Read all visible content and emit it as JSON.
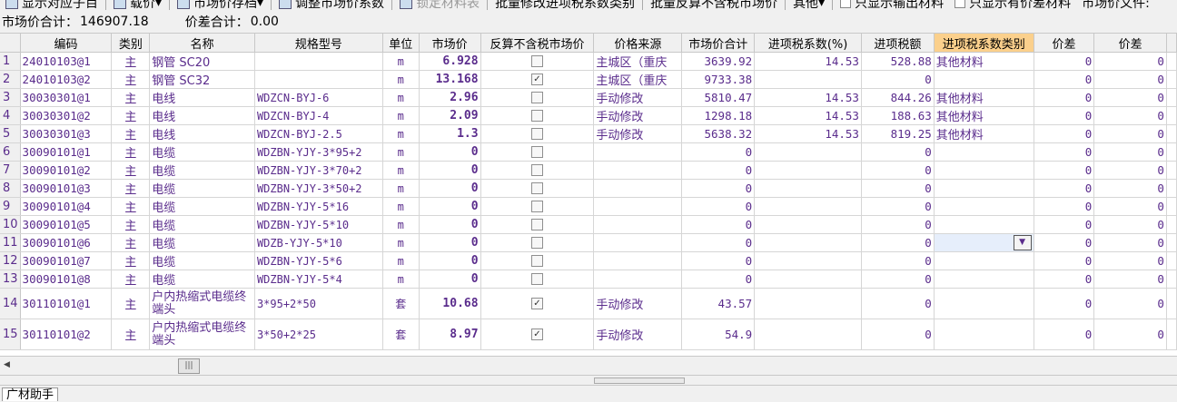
{
  "toolbar": {
    "items": [
      {
        "label": "显示对应子目",
        "icon": "display-icon"
      },
      {
        "label": "载价",
        "icon": "load-price-icon",
        "dropdown": true
      },
      {
        "label": "市场价存档",
        "icon": "archive-icon",
        "dropdown": true
      },
      {
        "label": "调整市场价系数",
        "icon": "adjust-icon"
      },
      {
        "label": "锁定材料表",
        "icon": "lock-icon",
        "disabled": true
      },
      {
        "label": "批量修改进项税系数类别"
      },
      {
        "label": "批量反算不含税市场价"
      },
      {
        "label": "其他",
        "dropdown": true
      }
    ],
    "check_output": "只显示输出材料",
    "check_diff": "只显示有价差材料",
    "market_file": "市场价文件:"
  },
  "summary": {
    "market_total_label": "市场价合计：",
    "market_total_value": "146907.18",
    "diff_total_label": "价差合计：",
    "diff_total_value": "0.00"
  },
  "columns": [
    "编码",
    "类别",
    "名称",
    "规格型号",
    "单位",
    "市场价",
    "反算不含税市场价",
    "价格来源",
    "市场价合计",
    "进项税系数(%)",
    "进项税额",
    "进项税系数类别",
    "价差",
    "价差"
  ],
  "rows": [
    {
      "n": "1",
      "code": "24010103@1",
      "type": "主",
      "name": "钢管 SC20",
      "spec": "",
      "unit": "m",
      "price": "6.928",
      "checked": false,
      "source": "主城区（重庆",
      "total": "3639.92",
      "rate": "14.53",
      "tax": "528.88",
      "cat": "其他材料",
      "d1": "0",
      "d2": "0"
    },
    {
      "n": "2",
      "code": "24010103@2",
      "type": "主",
      "name": "钢管 SC32",
      "spec": "",
      "unit": "m",
      "price": "13.168",
      "checked": true,
      "source": "主城区（重庆",
      "total": "9733.38",
      "rate": "",
      "tax": "0",
      "cat": "",
      "d1": "0",
      "d2": "0"
    },
    {
      "n": "3",
      "code": "30030301@1",
      "type": "主",
      "name": "电线",
      "spec": "WDZCN-BYJ-6",
      "unit": "m",
      "price": "2.96",
      "checked": false,
      "source": "手动修改",
      "total": "5810.47",
      "rate": "14.53",
      "tax": "844.26",
      "cat": "其他材料",
      "d1": "0",
      "d2": "0"
    },
    {
      "n": "4",
      "code": "30030301@2",
      "type": "主",
      "name": "电线",
      "spec": "WDZCN-BYJ-4",
      "unit": "m",
      "price": "2.09",
      "checked": false,
      "source": "手动修改",
      "total": "1298.18",
      "rate": "14.53",
      "tax": "188.63",
      "cat": "其他材料",
      "d1": "0",
      "d2": "0"
    },
    {
      "n": "5",
      "code": "30030301@3",
      "type": "主",
      "name": "电线",
      "spec": "WDZCN-BYJ-2.5",
      "unit": "m",
      "price": "1.3",
      "checked": false,
      "source": "手动修改",
      "total": "5638.32",
      "rate": "14.53",
      "tax": "819.25",
      "cat": "其他材料",
      "d1": "0",
      "d2": "0"
    },
    {
      "n": "6",
      "code": "30090101@1",
      "type": "主",
      "name": "电缆",
      "spec": "WDZBN-YJY-3*95+2",
      "unit": "m",
      "price": "0",
      "checked": false,
      "source": "",
      "total": "0",
      "rate": "",
      "tax": "0",
      "cat": "",
      "d1": "0",
      "d2": "0"
    },
    {
      "n": "7",
      "code": "30090101@2",
      "type": "主",
      "name": "电缆",
      "spec": "WDZBN-YJY-3*70+2",
      "unit": "m",
      "price": "0",
      "checked": false,
      "source": "",
      "total": "0",
      "rate": "",
      "tax": "0",
      "cat": "",
      "d1": "0",
      "d2": "0"
    },
    {
      "n": "8",
      "code": "30090101@3",
      "type": "主",
      "name": "电缆",
      "spec": "WDZBN-YJY-3*50+2",
      "unit": "m",
      "price": "0",
      "checked": false,
      "source": "",
      "total": "0",
      "rate": "",
      "tax": "0",
      "cat": "",
      "d1": "0",
      "d2": "0"
    },
    {
      "n": "9",
      "code": "30090101@4",
      "type": "主",
      "name": "电缆",
      "spec": "WDZBN-YJY-5*16",
      "unit": "m",
      "price": "0",
      "checked": false,
      "source": "",
      "total": "0",
      "rate": "",
      "tax": "0",
      "cat": "",
      "d1": "0",
      "d2": "0"
    },
    {
      "n": "10",
      "code": "30090101@5",
      "type": "主",
      "name": "电缆",
      "spec": "WDZBN-YJY-5*10",
      "unit": "m",
      "price": "0",
      "checked": false,
      "source": "",
      "total": "0",
      "rate": "",
      "tax": "0",
      "cat": "",
      "d1": "0",
      "d2": "0"
    },
    {
      "n": "11",
      "code": "30090101@6",
      "type": "主",
      "name": "电缆",
      "spec": "WDZB-YJY-5*10",
      "unit": "m",
      "price": "0",
      "checked": false,
      "source": "",
      "total": "0",
      "rate": "",
      "tax": "0",
      "cat": "",
      "d1": "0",
      "d2": "0",
      "selected": true
    },
    {
      "n": "12",
      "code": "30090101@7",
      "type": "主",
      "name": "电缆",
      "spec": "WDZBN-YJY-5*6",
      "unit": "m",
      "price": "0",
      "checked": false,
      "source": "",
      "total": "0",
      "rate": "",
      "tax": "0",
      "cat": "",
      "d1": "0",
      "d2": "0"
    },
    {
      "n": "13",
      "code": "30090101@8",
      "type": "主",
      "name": "电缆",
      "spec": "WDZBN-YJY-5*4",
      "unit": "m",
      "price": "0",
      "checked": false,
      "source": "",
      "total": "0",
      "rate": "",
      "tax": "0",
      "cat": "",
      "d1": "0",
      "d2": "0"
    },
    {
      "n": "14",
      "code": "30110101@1",
      "type": "主",
      "name": "户内热缩式电缆终端头",
      "spec": "3*95+2*50",
      "unit": "套",
      "price": "10.68",
      "checked": true,
      "source": "手动修改",
      "total": "43.57",
      "rate": "",
      "tax": "0",
      "cat": "",
      "d1": "0",
      "d2": "0",
      "tall": true
    },
    {
      "n": "15",
      "code": "30110101@2",
      "type": "主",
      "name": "户内热缩式电缆终端头",
      "spec": "3*50+2*25",
      "unit": "套",
      "price": "8.97",
      "checked": true,
      "source": "手动修改",
      "total": "54.9",
      "rate": "",
      "tax": "0",
      "cat": "",
      "d1": "0",
      "d2": "0",
      "tall": true
    }
  ],
  "bottom_tab": "广材助手"
}
